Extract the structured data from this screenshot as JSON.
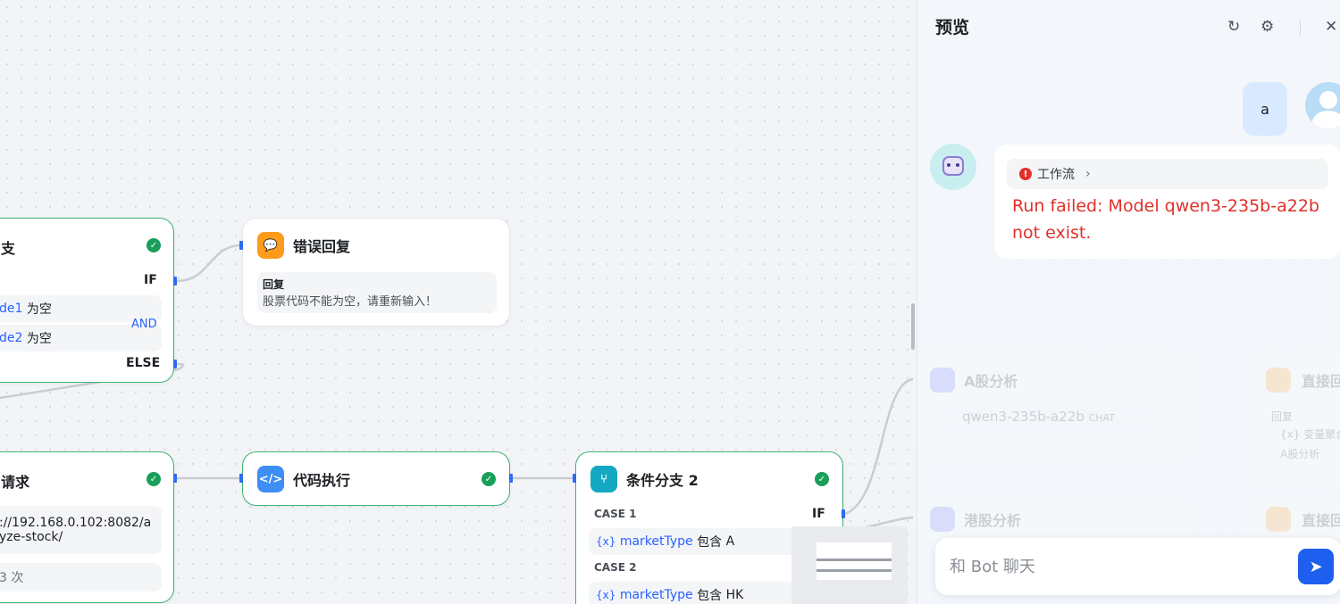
{
  "canvas": {
    "branch1": {
      "title_partial": "支",
      "if_label": "IF",
      "else_label": "ELSE",
      "and_label": "AND",
      "conditions": [
        {
          "var": "de1",
          "op": "为空"
        },
        {
          "var": "de2",
          "op": "为空"
        }
      ]
    },
    "error_reply": {
      "title": "错误回复",
      "label": "回复",
      "text": "股票代码不能为空，请重新输入！"
    },
    "http_node": {
      "title_partial": "请求",
      "url_line1": "://192.168.0.102:8082/a",
      "url_line2": "yze-stock/",
      "retry": "3 次"
    },
    "code_node": {
      "title": "代码执行"
    },
    "branch2": {
      "title": "条件分支 2",
      "case1_label": "CASE 1",
      "case2_label": "CASE 2",
      "if_label": "IF",
      "var_prefix": "{x}",
      "case1": {
        "var": "marketType",
        "op": "包含",
        "value": "A"
      },
      "case2": {
        "var": "marketType",
        "op": "包含",
        "value": "HK"
      }
    },
    "faded_nodes": {
      "a_analysis": "A股分析",
      "model": "qwen3-235b-a22b",
      "model_tag": "CHAT",
      "direct_reply": "直接回",
      "reply_label": "回复",
      "var_hint": "{x} 变量聚合",
      "a_hint": "A股分析",
      "hk_analysis": "港股分析",
      "direct_reply2": "直接回"
    }
  },
  "panel": {
    "title": "预览",
    "user_message": "a",
    "workflow_tag": "工作流",
    "error_message": "Run failed: Model qwen3-235b-a22b not exist.",
    "input_placeholder": "和 Bot 聊天"
  }
}
